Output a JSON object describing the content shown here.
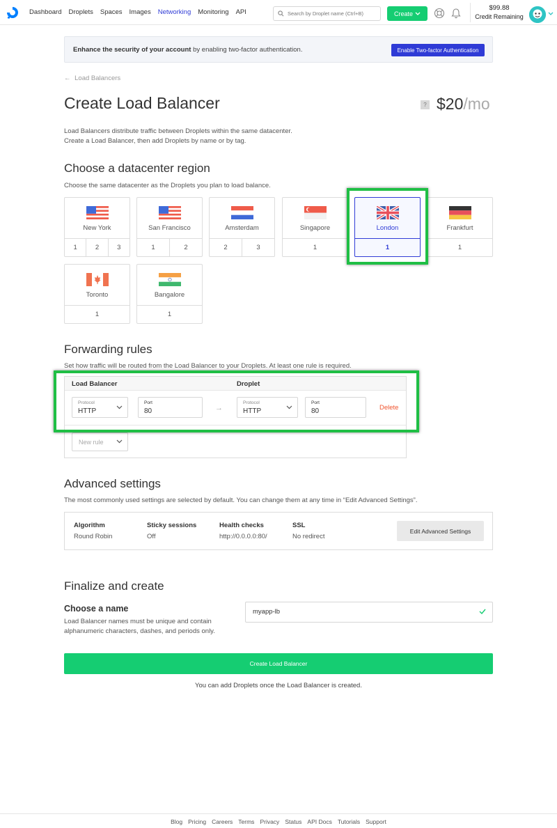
{
  "nav": {
    "links": [
      "Dashboard",
      "Droplets",
      "Spaces",
      "Images",
      "Networking",
      "Monitoring",
      "API"
    ],
    "active": "Networking",
    "search_placeholder": "Search by Droplet name (Ctrl+B)",
    "create_label": "Create",
    "credit_amount": "$99.88",
    "credit_label": "Credit Remaining",
    "icons": [
      "digitalocean-logo-icon",
      "search-icon",
      "help-lifebuoy-icon",
      "bell-icon",
      "avatar-icon"
    ]
  },
  "banner": {
    "bold": "Enhance the security of your account",
    "rest": " by enabling two-factor authentication.",
    "button": "Enable Two-factor Authentication"
  },
  "breadcrumb": "Load Balancers",
  "title": "Create Load Balancer",
  "price": {
    "help": "?",
    "amount": "$20",
    "period": "/mo"
  },
  "intro": {
    "line1": "Load Balancers distribute traffic between Droplets within the same datacenter.",
    "line2": "Create a Load Balancer, then add Droplets by name or by tag."
  },
  "datacenter": {
    "title": "Choose a datacenter region",
    "subtitle": "Choose the same datacenter as the Droplets you plan to load balance.",
    "selected": "London",
    "regions": [
      {
        "name": "New York",
        "flag": "us",
        "numbers": [
          "1",
          "2",
          "3"
        ]
      },
      {
        "name": "San Francisco",
        "flag": "us",
        "numbers": [
          "1",
          "2"
        ]
      },
      {
        "name": "Amsterdam",
        "flag": "nl",
        "numbers": [
          "2",
          "3"
        ]
      },
      {
        "name": "Singapore",
        "flag": "sg",
        "numbers": [
          "1"
        ]
      },
      {
        "name": "London",
        "flag": "gb",
        "numbers": [
          "1"
        ]
      },
      {
        "name": "Frankfurt",
        "flag": "de",
        "numbers": [
          "1"
        ]
      },
      {
        "name": "Toronto",
        "flag": "ca",
        "numbers": [
          "1"
        ]
      },
      {
        "name": "Bangalore",
        "flag": "in",
        "numbers": [
          "1"
        ]
      }
    ]
  },
  "forwarding": {
    "title": "Forwarding rules",
    "subtitle": "Set how traffic will be routed from the Load Balancer to your Droplets. At least one rule is required.",
    "col_lb": "Load Balancer",
    "col_droplet": "Droplet",
    "rule": {
      "lb_protocol_label": "Protocol",
      "lb_protocol": "HTTP",
      "lb_port_label": "Port",
      "lb_port": "80",
      "droplet_protocol_label": "Protocol",
      "droplet_protocol": "HTTP",
      "droplet_port_label": "Port",
      "droplet_port": "80",
      "delete": "Delete"
    },
    "new_rule": "New rule"
  },
  "advanced": {
    "title": "Advanced settings",
    "subtitle": "The most commonly used settings are selected by default. You can change them at any time in “Edit Advanced Settings”.",
    "items": [
      {
        "key": "Algorithm",
        "value": "Round Robin"
      },
      {
        "key": "Sticky sessions",
        "value": "Off"
      },
      {
        "key": "Health checks",
        "value": "http://0.0.0.0:80/"
      },
      {
        "key": "SSL",
        "value": "No redirect"
      }
    ],
    "edit_button": "Edit Advanced Settings"
  },
  "finalize": {
    "title": "Finalize and create",
    "name_title": "Choose a name",
    "name_help": "Load Balancer names must be unique and contain alphanumeric characters, dashes, and periods only.",
    "name_value": "myapp-lb",
    "create_button": "Create Load Balancer",
    "note": "You can add Droplets once the Load Balancer is created."
  },
  "footer": [
    "Blog",
    "Pricing",
    "Careers",
    "Terms",
    "Privacy",
    "Status",
    "API Docs",
    "Tutorials",
    "Support"
  ],
  "colors": {
    "accent": "#2f3bd6",
    "green": "#15cd72",
    "highlight": "#1fbf45",
    "danger": "#f0552f"
  }
}
